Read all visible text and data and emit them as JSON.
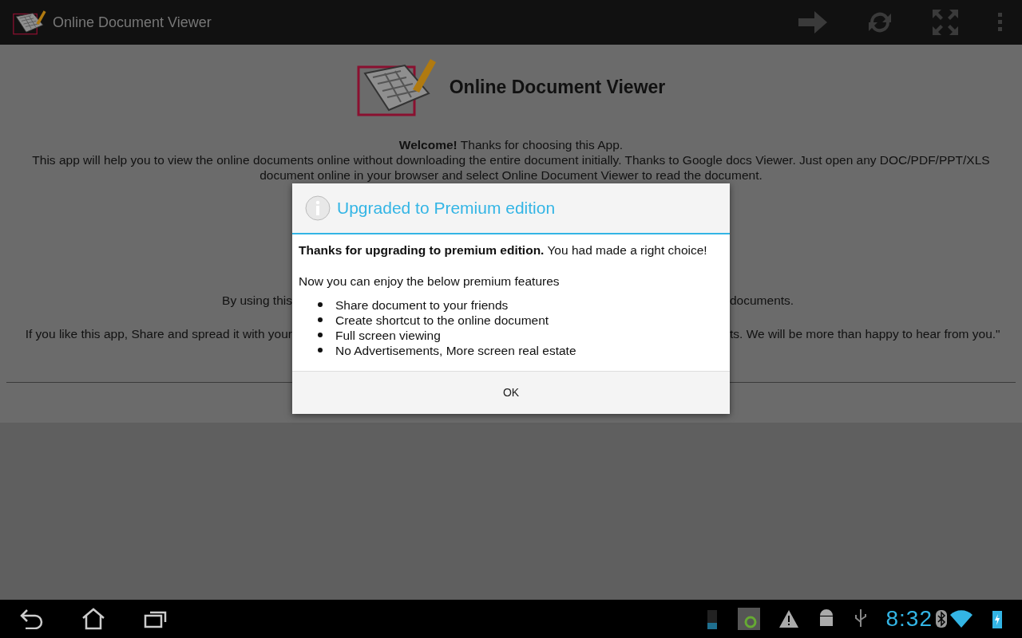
{
  "action_bar": {
    "title": "Online Document Viewer"
  },
  "page": {
    "title": "Online Document Viewer",
    "welcome": "**Welcome!** Thanks for choosing this App.",
    "intro": "This app will help you to view the online documents online without downloading the entire document initially. Thanks to Google docs Viewer. Just open any DOC/PDF/PPT/XLS document online in your browser and select Online Document Viewer to read the document.",
    "partial_lines": [
      {
        "left": "By using this",
        "right": "documents."
      },
      {
        "left": "If you like this app, Share and spread it with your",
        "right": "ts. We will be more than happy to hear from you.\""
      }
    ]
  },
  "dialog": {
    "title": "Upgraded to Premium edition",
    "message": "**Thanks for upgrading to premium edition.** You had made a right choice!",
    "lead": "Now you can enjoy the below premium features",
    "features": [
      "Share document to your friends",
      "Create shortcut to the online document",
      "Full screen viewing",
      "No Advertisements, More screen real estate"
    ],
    "button": "OK"
  },
  "status_bar": {
    "time": "8:32"
  }
}
